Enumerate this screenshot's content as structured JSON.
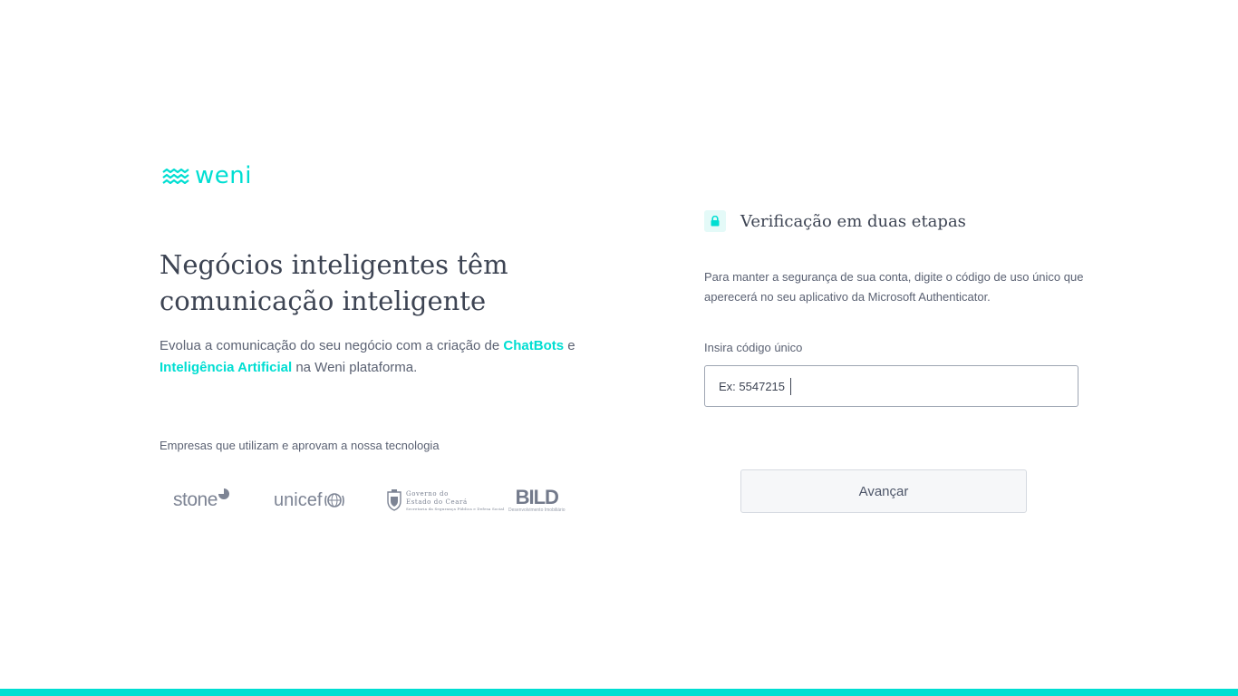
{
  "brand": {
    "logo_text": "weni",
    "accent_color": "#00ded2"
  },
  "hero": {
    "headline": "Negócios inteligentes têm comunicação inteligente",
    "subtitle_prefix": "Evolua a comunicação do seu negócio com a criação de",
    "highlight_1": "ChatBots",
    "connector": "e",
    "highlight_2": "Inteligência Artificial",
    "subtitle_suffix": "na Weni plataforma."
  },
  "companies": {
    "label": "Empresas que utilizam e aprovam a nossa tecnologia",
    "logos": [
      {
        "name": "stone",
        "text": "stone"
      },
      {
        "name": "unicef",
        "text": "unicef"
      },
      {
        "name": "governo-ceara",
        "line1": "Governo do",
        "line2": "Estado do Ceará",
        "line3": "Secretaria da Segurança Pública e Defesa Social"
      },
      {
        "name": "bild",
        "text": "BILD",
        "subtext": "Desenvolvimento Imobiliário"
      }
    ]
  },
  "form": {
    "lock_icon": "lock-icon",
    "title": "Verificação em duas etapas",
    "description": "Para manter a segurança de sua conta, digite o código de uso único que aperecerá no seu aplicativo da Microsoft Authenticator.",
    "input_label": "Insira código único",
    "input_placeholder": "Ex: 5547215",
    "input_value": "",
    "submit_label": "Avançar"
  }
}
